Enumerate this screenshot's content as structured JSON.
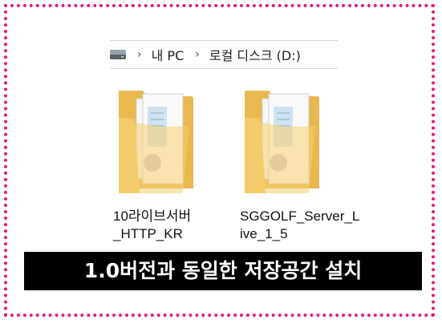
{
  "breadcrumb": {
    "items": [
      "내 PC",
      "로컬 디스크 (D:)"
    ],
    "separator": "›"
  },
  "folders": [
    {
      "name_line1": "10라이브서버",
      "name_line2": "_HTTP_KR"
    },
    {
      "name_line1": "SGGOLF_Server_L",
      "name_line2": "ive_1_5"
    }
  ],
  "banner": {
    "text": "1.0버전과 동일한 저장공간 설치"
  },
  "colors": {
    "frame": "#e8197a",
    "banner_bg": "#000000",
    "folder": "#f3c766"
  }
}
